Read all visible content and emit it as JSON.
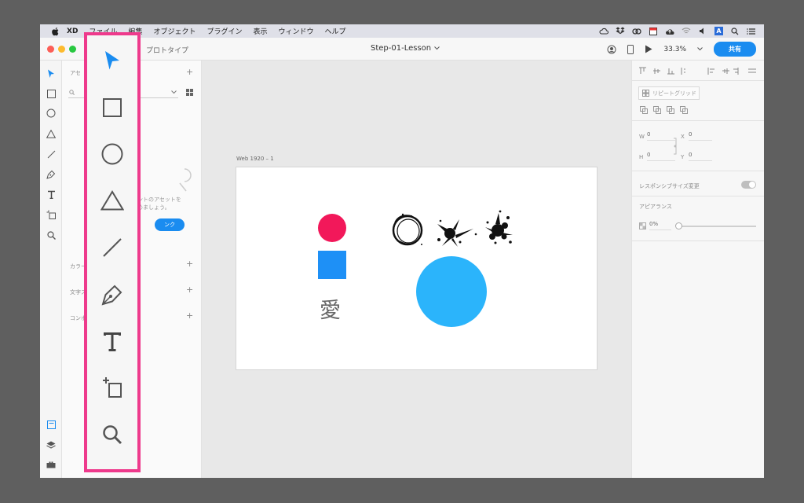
{
  "menubar": {
    "app": "XD",
    "items": [
      "ファイル",
      "編集",
      "オブジェクト",
      "プラグイン",
      "表示",
      "ウィンドウ",
      "ヘルプ"
    ],
    "status_icons": [
      "cloud-check-icon",
      "dropbox-icon",
      "creative-cloud-icon",
      "calendar-icon",
      "cloud-upload-icon",
      "wifi-icon",
      "volume-icon",
      "input-source-icon",
      "spotlight-icon",
      "control-center-icon"
    ],
    "input_source_label": "A"
  },
  "titlebar": {
    "tab_prototype": "プロトタイプ",
    "doc_title": "Step-01-Lesson",
    "zoom": "33.3%",
    "share_label": "共有"
  },
  "assets": {
    "header": "アセ",
    "hint_line1": "ントのアセットを",
    "hint_line2": "めましょう。",
    "link_label": "ンク",
    "colors_label": "カラー",
    "chars_label": "文字ス",
    "components_label": "コンポ"
  },
  "canvas": {
    "artboard_name": "Web 1920 – 1",
    "kanji": "愛",
    "colors": {
      "pink": "#f2185a",
      "blue_square": "#1e90f6",
      "big_circle": "#2bb4fb"
    }
  },
  "inspector": {
    "repeat_grid": "リピートグリッド",
    "w_label": "W",
    "w_value": "0",
    "h_label": "H",
    "h_value": "0",
    "x_label": "X",
    "x_value": "0",
    "y_label": "Y",
    "y_value": "0",
    "responsive": "レスポンシブサイズ変更",
    "appearance": "アピアランス",
    "opacity": "0%"
  },
  "tools": [
    "select-tool",
    "rectangle-tool",
    "ellipse-tool",
    "triangle-tool",
    "line-tool",
    "pen-tool",
    "text-tool",
    "artboard-tool",
    "zoom-tool"
  ],
  "accent": {
    "highlight": "#ee3a8c",
    "primary": "#1a8cf0"
  }
}
